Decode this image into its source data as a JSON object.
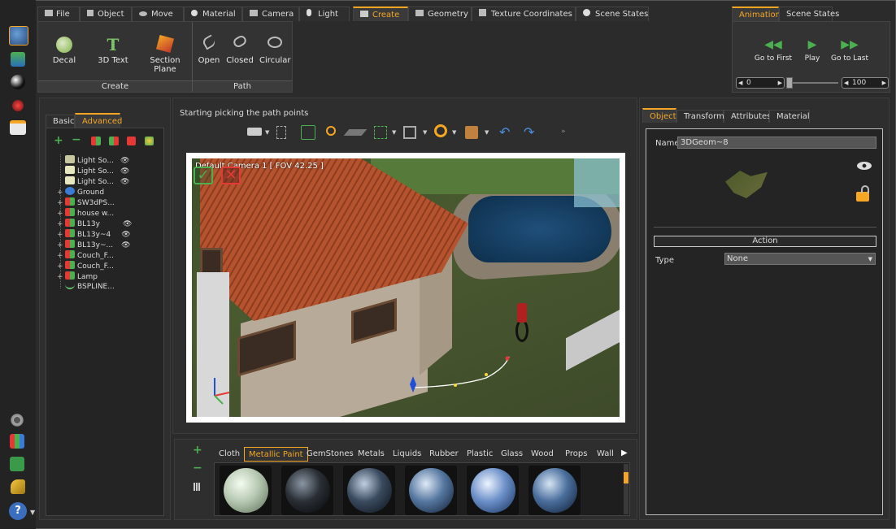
{
  "menu": [
    "File",
    "Object",
    "Move",
    "Material",
    "Camera",
    "Light",
    "Create",
    "Geometry",
    "Texture Coordinates",
    "Scene States"
  ],
  "menu_active": "Create",
  "anim_tabs": [
    "Animation",
    "Scene States"
  ],
  "ribbon": {
    "create_group_label": "Create",
    "path_group_label": "Path",
    "buttons": [
      "Decal",
      "3D Text",
      "Section Plane",
      "Open",
      "Closed",
      "Circular"
    ]
  },
  "animation": {
    "buttons": [
      "Go to First",
      "Play",
      "Go to Last"
    ],
    "start_value": "0",
    "end_value": "100"
  },
  "left_panel": {
    "tabs": [
      "Basic",
      "Advanced"
    ],
    "active_tab": "Advanced",
    "tree": [
      {
        "label": "Light So...",
        "expand": "",
        "eye": true,
        "color": "#c8c8a0"
      },
      {
        "label": "Light So...",
        "expand": "",
        "eye": true,
        "color": "#e8e8c0"
      },
      {
        "label": "Light So...",
        "expand": "",
        "eye": true,
        "color": "#e8e8c0"
      },
      {
        "label": "Ground",
        "expand": "+",
        "eye": false,
        "color": "#3a7bd5"
      },
      {
        "label": "SW3dPS...",
        "expand": "+",
        "eye": false,
        "color": "#4caf50"
      },
      {
        "label": "house w...",
        "expand": "+",
        "eye": false,
        "color": "#4caf50"
      },
      {
        "label": "BL13y",
        "expand": "+",
        "eye": true,
        "color": "#e53935"
      },
      {
        "label": "BL13y~4",
        "expand": "+",
        "eye": true,
        "color": "#e53935"
      },
      {
        "label": "BL13y~...",
        "expand": "+",
        "eye": true,
        "color": "#e53935"
      },
      {
        "label": "Couch_F...",
        "expand": "+",
        "eye": false,
        "color": "#e53935"
      },
      {
        "label": "Couch_F...",
        "expand": "+",
        "eye": false,
        "color": "#e53935"
      },
      {
        "label": "Lamp",
        "expand": "+",
        "eye": false,
        "color": "#e53935"
      },
      {
        "label": "BSPLINE...",
        "expand": "",
        "eye": false,
        "color": "#66bb6a"
      }
    ]
  },
  "viewport": {
    "status": "Starting picking the path points",
    "camera_label": "Default Camera 1 [ FOV 42.25 ]"
  },
  "materials": {
    "tabs": [
      "Cloth",
      "Metallic Paint",
      "GemStones",
      "Metals",
      "Liquids",
      "Rubber",
      "Plastic",
      "Glass",
      "Wood",
      "Props",
      "Wall"
    ],
    "active_tab": "Metallic Paint",
    "swatches": [
      "#b7c9b2",
      "#2a2f35",
      "#3a4a5e",
      "#5577a0",
      "#6b8fc8",
      "#4a6e9c"
    ]
  },
  "right_panel": {
    "tabs": [
      "Object",
      "Transform",
      "Attributes",
      "Material"
    ],
    "active_tab": "Object",
    "name_label": "Name",
    "name_value": "3DGeom~8",
    "action_label": "Action",
    "type_label": "Type",
    "type_value": "None"
  },
  "colors": {
    "accent": "#f5a623",
    "background": "#2a2a2a"
  }
}
